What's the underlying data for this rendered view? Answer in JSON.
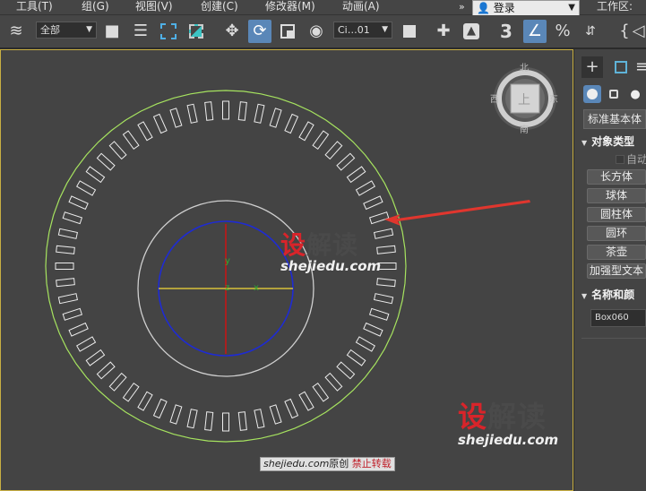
{
  "menu": {
    "items": [
      {
        "label": "工具(T)",
        "key": "tools"
      },
      {
        "label": "组(G)",
        "key": "group"
      },
      {
        "label": "视图(V)",
        "key": "views"
      },
      {
        "label": "创建(C)",
        "key": "create"
      },
      {
        "label": "修改器(M)",
        "key": "modifiers"
      },
      {
        "label": "动画(A)",
        "key": "animation"
      }
    ],
    "overflow": "»",
    "login_label": "登录",
    "workspace_label": "工作区:"
  },
  "toolbar": {
    "selection_filter": "全部",
    "reference_coord": "Ci…01",
    "snap_label": "3"
  },
  "viewcube": {
    "north": "北",
    "south": "南",
    "east": "东",
    "west": "西",
    "face": "上"
  },
  "viewport": {
    "axis_y": "y",
    "axis_x": "x",
    "axis_z": "z"
  },
  "watermark": {
    "brand_red": "设",
    "brand_rest": "解读",
    "url": "shejiedu.com"
  },
  "credit": {
    "url": "shejiedu.com",
    "original": "原创",
    "no_repost": "禁止转载"
  },
  "command_panel": {
    "category": "标准基本体",
    "section_object_type": "对象类型",
    "autogrid": "自动",
    "buttons": [
      "长方体",
      "球体",
      "圆柱体",
      "圆环",
      "茶壶",
      "加强型文本"
    ],
    "section_name_color": "名称和颜",
    "object_name": "Box060"
  },
  "colors": {
    "outer_ring": "#a6e35f",
    "blue_circle": "#1e2bd4",
    "white_circle": "#cfcfcf",
    "axis_red": "#c41616",
    "axis_yellow": "#d6c13a",
    "viewport_border": "#c9b043",
    "arrow": "#e0362e"
  }
}
